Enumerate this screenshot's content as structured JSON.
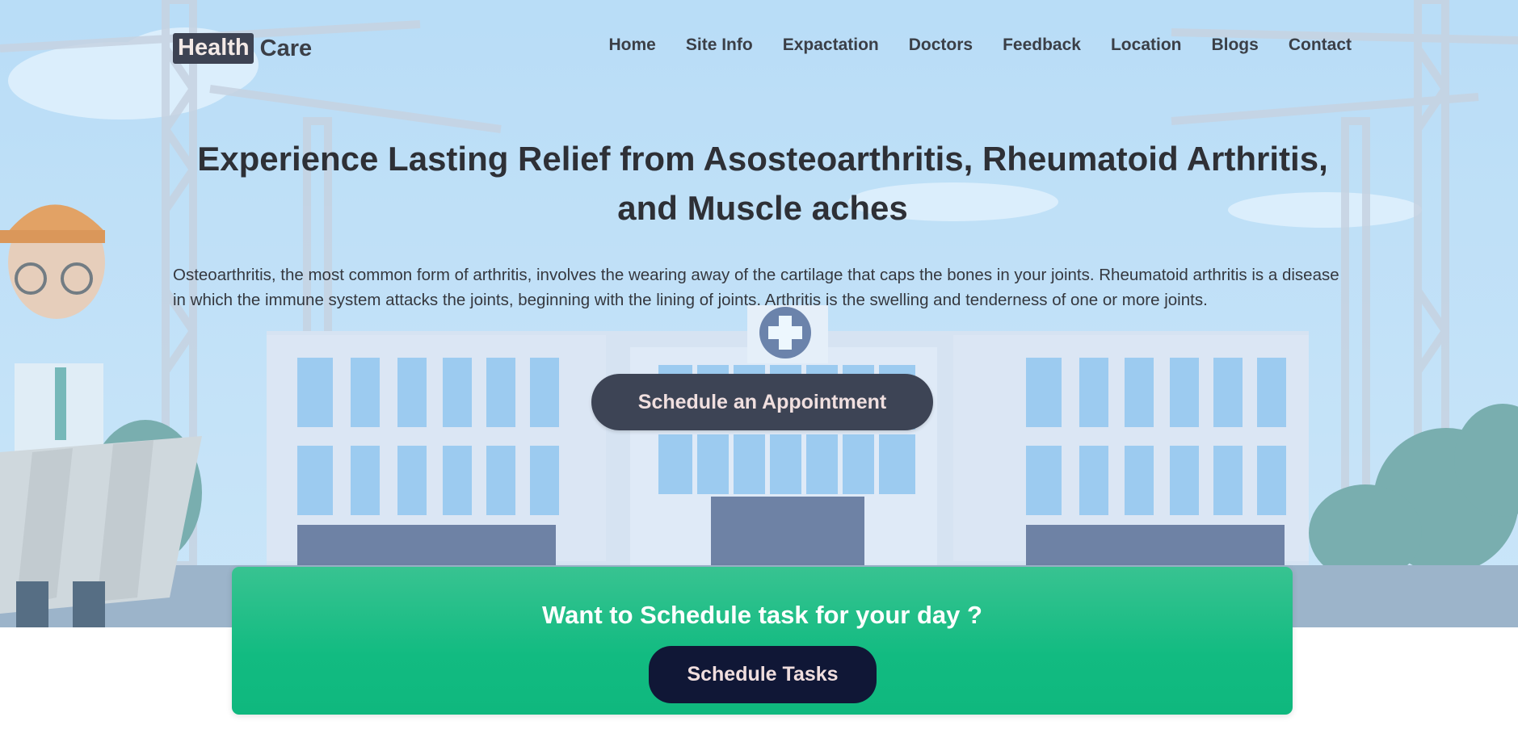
{
  "brand": {
    "part1": "Health",
    "part2": "Care"
  },
  "nav": {
    "items": [
      {
        "label": "Home"
      },
      {
        "label": "Site Info"
      },
      {
        "label": "Expactation"
      },
      {
        "label": "Doctors"
      },
      {
        "label": "Feedback"
      },
      {
        "label": "Location"
      },
      {
        "label": "Blogs"
      },
      {
        "label": "Contact"
      }
    ]
  },
  "hero": {
    "title": "Experience Lasting Relief from Asosteoarthritis, Rheumatoid Arthritis, and Muscle aches",
    "description": "Osteoarthritis, the most common form of arthritis, involves the wearing away of the cartilage that caps the bones in your joints. Rheumatoid arthritis is a disease in which the immune system attacks the joints, beginning with the lining of joints. Arthritis is the swelling and tenderness of one or more joints.",
    "cta_label": "Schedule an Appointment",
    "background_image": "hospital-construction-illustration"
  },
  "task_card": {
    "title": "Want to Schedule task for your day ?",
    "button_label": "Schedule Tasks"
  },
  "colors": {
    "brand_dark": "#3d4353",
    "appointment_button": "#3d4455",
    "card_green": "#12bb81",
    "task_button": "#101736"
  }
}
